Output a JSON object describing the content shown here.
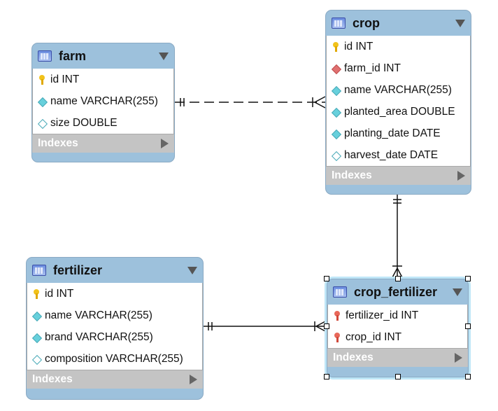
{
  "tables": {
    "farm": {
      "name": "farm",
      "columns": [
        {
          "label": "id INT",
          "icon": "primary-key"
        },
        {
          "label": "name VARCHAR(255)",
          "icon": "not-null-column"
        },
        {
          "label": "size DOUBLE",
          "icon": "nullable-column"
        }
      ],
      "indexes": "Indexes"
    },
    "crop": {
      "name": "crop",
      "columns": [
        {
          "label": "id INT",
          "icon": "primary-key"
        },
        {
          "label": "farm_id INT",
          "icon": "foreign-key-column"
        },
        {
          "label": "name VARCHAR(255)",
          "icon": "not-null-column"
        },
        {
          "label": "planted_area DOUBLE",
          "icon": "not-null-column"
        },
        {
          "label": "planting_date DATE",
          "icon": "not-null-column"
        },
        {
          "label": "harvest_date DATE",
          "icon": "nullable-column"
        }
      ],
      "indexes": "Indexes"
    },
    "fertilizer": {
      "name": "fertilizer",
      "columns": [
        {
          "label": "id INT",
          "icon": "primary-key"
        },
        {
          "label": "name VARCHAR(255)",
          "icon": "not-null-column"
        },
        {
          "label": "brand VARCHAR(255)",
          "icon": "not-null-column"
        },
        {
          "label": "composition VARCHAR(255)",
          "icon": "nullable-column"
        }
      ],
      "indexes": "Indexes"
    },
    "crop_fertilizer": {
      "name": "crop_fertilizer",
      "selected": true,
      "columns": [
        {
          "label": "fertilizer_id INT",
          "icon": "primary-foreign-key"
        },
        {
          "label": "crop_id INT",
          "icon": "primary-foreign-key"
        }
      ],
      "indexes": "Indexes"
    }
  },
  "relationships": [
    {
      "from": "farm",
      "to": "crop",
      "type": "one-to-many",
      "identifying": false
    },
    {
      "from": "crop",
      "to": "crop_fertilizer",
      "type": "one-to-many",
      "identifying": true
    },
    {
      "from": "fertilizer",
      "to": "crop_fertilizer",
      "type": "one-to-many",
      "identifying": true
    }
  ]
}
